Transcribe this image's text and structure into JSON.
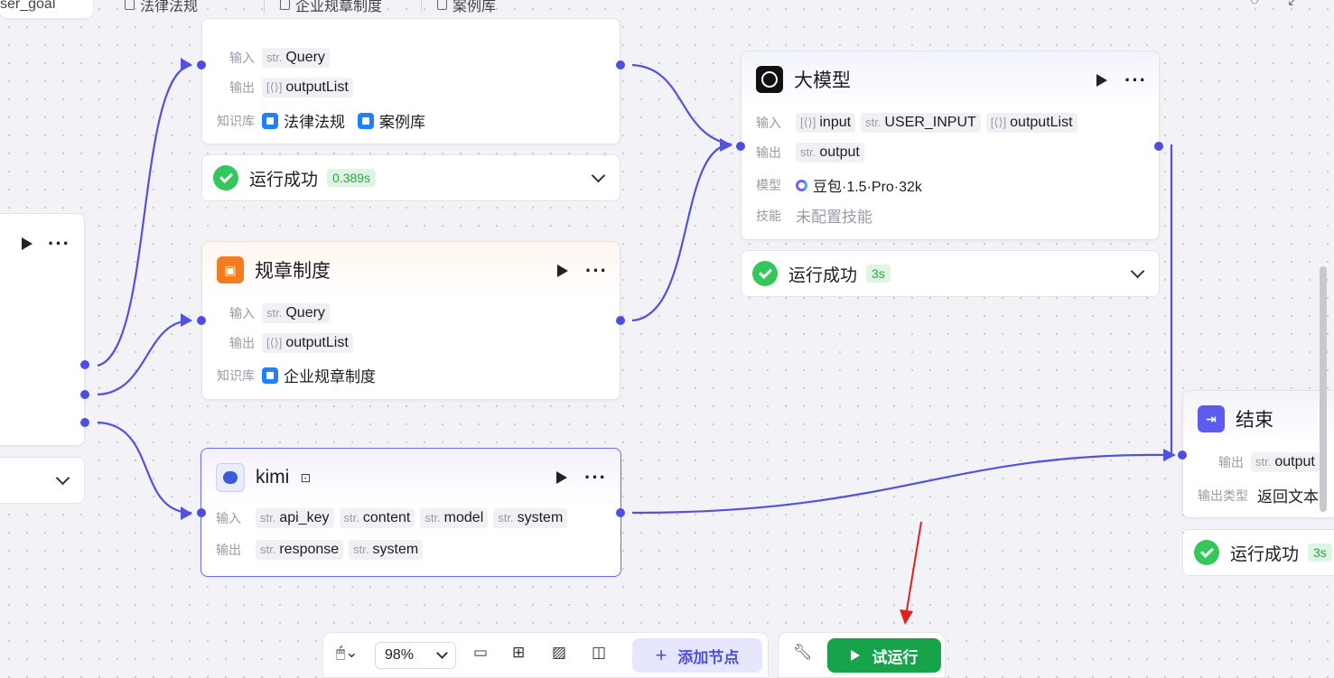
{
  "tabs": [
    {
      "label": "ser_goal"
    },
    {
      "label": "法律法规"
    },
    {
      "label": "企业规章制度"
    },
    {
      "label": "案例库"
    }
  ],
  "labels": {
    "input": "输入",
    "output": "输出",
    "knowledge": "知识库",
    "model": "模型",
    "skill": "技能",
    "output_type": "输出类型"
  },
  "type_tags": {
    "str": "str.",
    "list": "[⟨⟩]"
  },
  "node_top": {
    "inputs": [
      {
        "type": "str",
        "name": "Query"
      }
    ],
    "outputs": [
      {
        "type": "list",
        "name": "outputList"
      }
    ],
    "knowledge": [
      "法律法规",
      "案例库"
    ],
    "status": "运行成功",
    "time": "0.389s"
  },
  "node_rules": {
    "title": "规章制度",
    "inputs": [
      {
        "type": "str",
        "name": "Query"
      }
    ],
    "outputs": [
      {
        "type": "list",
        "name": "outputList"
      }
    ],
    "knowledge": [
      "企业规章制度"
    ]
  },
  "node_kimi": {
    "title": "kimi",
    "inputs": [
      {
        "type": "str",
        "name": "api_key"
      },
      {
        "type": "str",
        "name": "content"
      },
      {
        "type": "str",
        "name": "model"
      },
      {
        "type": "str",
        "name": "system"
      }
    ],
    "outputs": [
      {
        "type": "str",
        "name": "response"
      },
      {
        "type": "str",
        "name": "system"
      }
    ]
  },
  "node_llm": {
    "title": "大模型",
    "inputs": [
      {
        "type": "list",
        "name": "input"
      },
      {
        "type": "str",
        "name": "USER_INPUT"
      },
      {
        "type": "list",
        "name": "outputList"
      }
    ],
    "outputs": [
      {
        "type": "str",
        "name": "output"
      }
    ],
    "model": "豆包·1.5·Pro·32k",
    "skill": "未配置技能",
    "status": "运行成功",
    "time": "3s"
  },
  "node_end": {
    "title": "结束",
    "outputs": [
      {
        "type": "str",
        "name": "output"
      }
    ],
    "output_type": "返回文本",
    "status": "运行成功",
    "time": "3s"
  },
  "toolbar": {
    "zoom": "98%",
    "add_node": "添加节点",
    "run": "试运行"
  },
  "colors": {
    "accent": "#4d4ddf",
    "run_green": "#16a34a",
    "success_green": "#34c759",
    "annotation_arrow": "#e02020"
  },
  "icons": [
    "mouse-icon",
    "comment-icon",
    "grid-icon",
    "image-icon",
    "note-icon",
    "wrench-icon",
    "play-icon",
    "more-icon",
    "chevron-down-icon",
    "check-icon",
    "refresh-icon",
    "fullscreen-icon"
  ]
}
